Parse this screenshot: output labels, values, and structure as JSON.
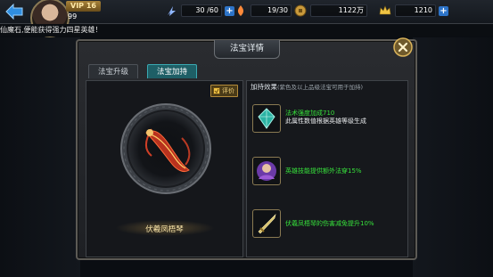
{
  "header": {
    "vip": "VIP 16",
    "level": "99",
    "stamina": "30 /60",
    "energy": "19/30",
    "coins": "1122万",
    "gold": "1210"
  },
  "notice": "仙魔石,便能获得强力四星英雄！",
  "dialog": {
    "title": "法宝详情",
    "tabs": [
      "法宝升级",
      "法宝加持"
    ],
    "active_tab": "法宝加持",
    "rate_label": "评价",
    "item_name": "伏羲凤梧琴",
    "effects_title": "加持效果",
    "effects_note": "(紫色及以上品级法宝可用于加持)",
    "effects": [
      {
        "line1": "法术强度加成710",
        "line2": "此属性数值根据英雄等级生成"
      },
      {
        "line1": "英雄技能提供额外法穿15%"
      },
      {
        "line1": "伏羲凤梧琴的伤害减免提升10%"
      }
    ]
  },
  "colors": {
    "accent_green": "#37e23b",
    "tab_active": "#1e5f66",
    "gold_text": "#f5e1a6"
  },
  "icons": [
    "back-arrow-icon",
    "stamina-icon",
    "energy-icon",
    "coin-icon",
    "gold-crown-icon",
    "plus-icon",
    "close-icon",
    "rate-icon"
  ]
}
